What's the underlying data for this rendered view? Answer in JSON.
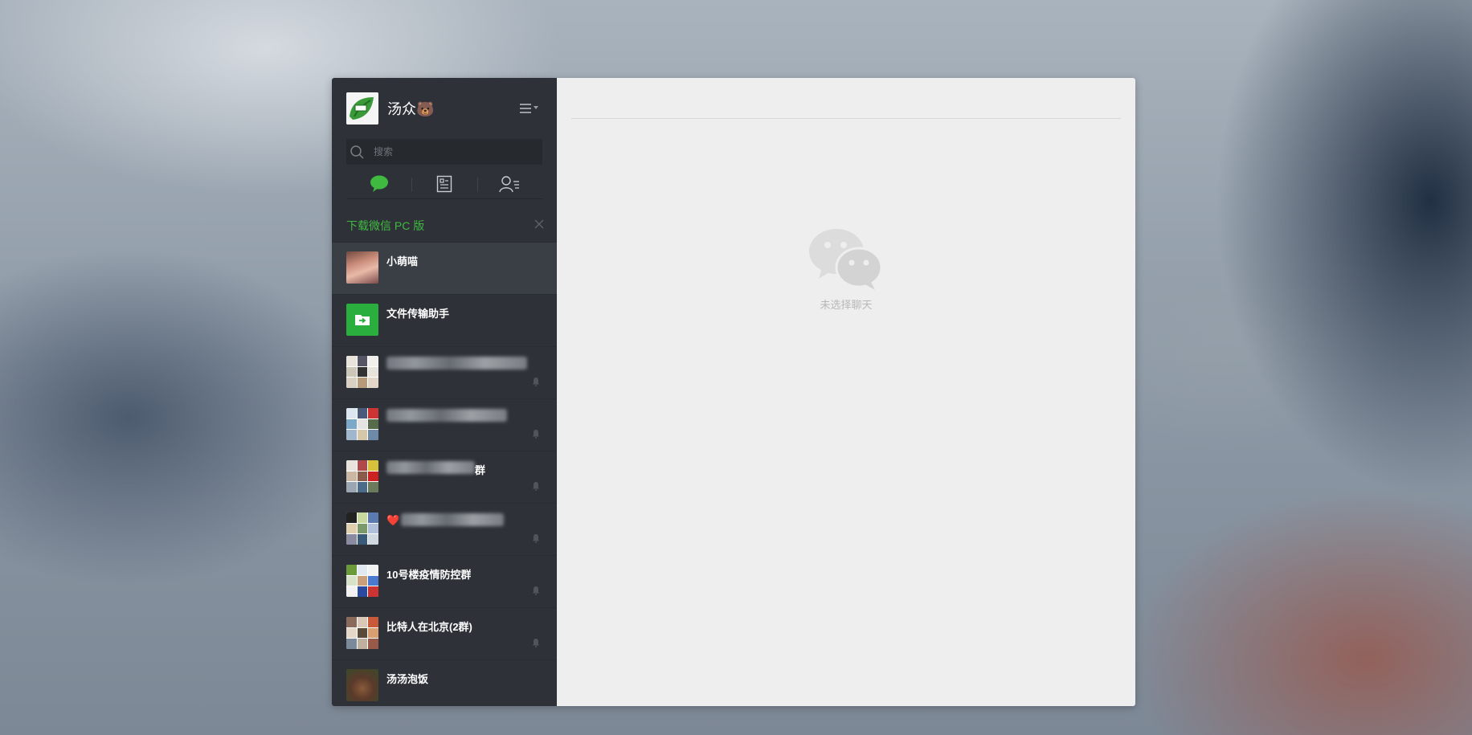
{
  "profile": {
    "name": "汤众🐻",
    "avatar_icon": "green-leaf-avatar-icon"
  },
  "search": {
    "placeholder": "搜索"
  },
  "nav_tabs": [
    {
      "name": "chat",
      "icon": "chat-bubble-icon",
      "active": true
    },
    {
      "name": "articles",
      "icon": "document-icon",
      "active": false
    },
    {
      "name": "contacts",
      "icon": "contacts-icon",
      "active": false
    }
  ],
  "download_banner": {
    "label": "下载微信 PC 版"
  },
  "chats": [
    {
      "name": "小萌喵",
      "avatar": "photo-girl",
      "muted": false,
      "active": true
    },
    {
      "name": "文件传输助手",
      "avatar": "file-transfer-icon",
      "muted": false,
      "active": false
    },
    {
      "name": "",
      "avatar": "group-mosaic",
      "muted": true,
      "obscured": true
    },
    {
      "name": "",
      "avatar": "group-mosaic",
      "muted": true,
      "obscured": true
    },
    {
      "name": "群",
      "avatar": "group-mosaic",
      "muted": true,
      "obscured": true
    },
    {
      "name": "❤️",
      "avatar": "group-mosaic",
      "muted": true,
      "obscured": true
    },
    {
      "name": "10号楼疫情防控群",
      "avatar": "group-mosaic",
      "muted": true,
      "active": false
    },
    {
      "name": "比特人在北京(2群)",
      "avatar": "group-mosaic",
      "muted": true,
      "active": false
    },
    {
      "name": "汤汤泡饭",
      "avatar": "photo-food",
      "muted": false,
      "active": false
    }
  ],
  "main": {
    "empty_caption": "未选择聊天"
  },
  "colors": {
    "sidebar": "#2e3238",
    "accent_green": "#3fb93f",
    "main_bg": "#eeeeee"
  }
}
